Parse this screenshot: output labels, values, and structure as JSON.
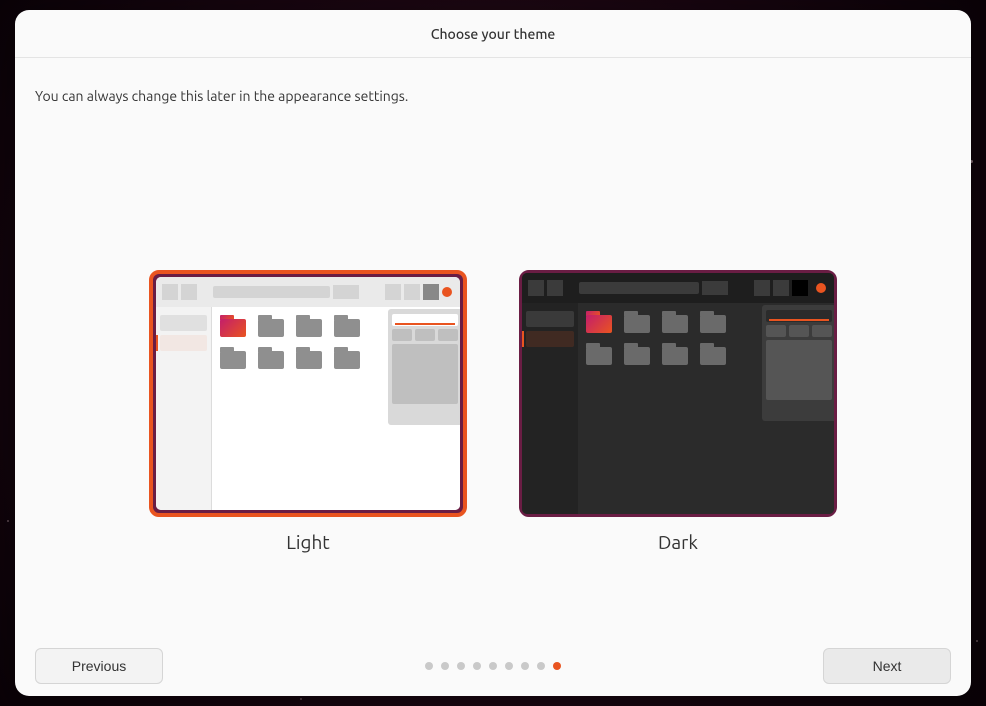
{
  "header": {
    "title": "Choose your theme"
  },
  "subtitle": "You can always change this later in the appearance settings.",
  "themes": {
    "light": {
      "label": "Light",
      "selected": true
    },
    "dark": {
      "label": "Dark",
      "selected": false
    }
  },
  "buttons": {
    "previous": "Previous",
    "next": "Next"
  },
  "pager": {
    "total": 9,
    "current": 9
  },
  "colors": {
    "accent": "#E95420",
    "selection_ring": "#E95420",
    "frame_purple": "#6a1d44"
  }
}
